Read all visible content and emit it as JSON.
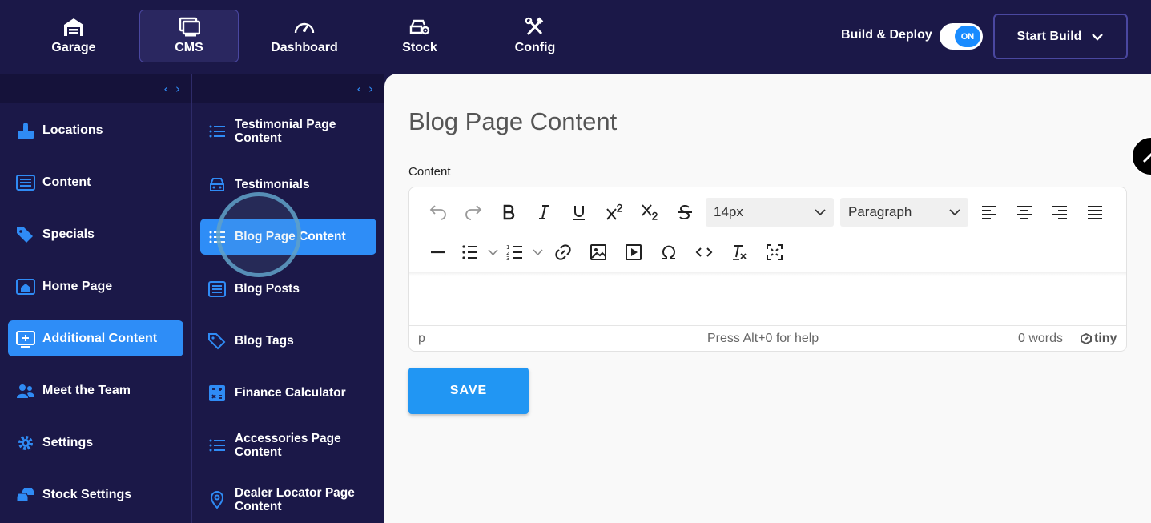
{
  "topnav": {
    "items": [
      {
        "label": "Garage",
        "icon": "garage-icon"
      },
      {
        "label": "CMS",
        "icon": "monitor-icon",
        "active": true
      },
      {
        "label": "Dashboard",
        "icon": "gauge-icon"
      },
      {
        "label": "Stock",
        "icon": "car-gear-icon"
      },
      {
        "label": "Config",
        "icon": "tools-icon"
      }
    ],
    "deploy_label": "Build & Deploy",
    "toggle_text": "ON",
    "start_build_label": "Start Build"
  },
  "sidebar": {
    "items": [
      {
        "label": "Locations",
        "icon": "location-building-icon"
      },
      {
        "label": "Content",
        "icon": "list-box-icon"
      },
      {
        "label": "Specials",
        "icon": "tags-icon"
      },
      {
        "label": "Home Page",
        "icon": "home-box-icon"
      },
      {
        "label": "Additional Content",
        "icon": "add-box-icon",
        "active": true
      },
      {
        "label": "Meet the Team",
        "icon": "people-icon"
      },
      {
        "label": "Settings",
        "icon": "gear-icon"
      },
      {
        "label": "Stock Settings",
        "icon": "cars-icon"
      }
    ]
  },
  "subnav": {
    "items": [
      {
        "label": "Testimonial Page Content",
        "icon": "list-icon"
      },
      {
        "label": "Testimonials",
        "icon": "car-icon"
      },
      {
        "label": "Blog Page Content",
        "icon": "list-icon",
        "active": true
      },
      {
        "label": "Blog Posts",
        "icon": "list-box-icon"
      },
      {
        "label": "Blog Tags",
        "icon": "tags-icon"
      },
      {
        "label": "Finance Calculator",
        "icon": "calculator-icon"
      },
      {
        "label": "Accessories Page Content",
        "icon": "list-icon"
      },
      {
        "label": "Dealer Locator Page Content",
        "icon": "map-pin-icon"
      }
    ]
  },
  "main": {
    "title": "Blog Page Content",
    "field_label": "Content",
    "editor": {
      "font_size": "14px",
      "block_format": "Paragraph",
      "status_path": "p",
      "help_text": "Press Alt+0 for help",
      "word_count": "0 words",
      "brand": "tiny"
    },
    "save_label": "SAVE"
  },
  "colors": {
    "nav_bg": "#1b1848",
    "accent": "#2e8df7",
    "save": "#2196f3",
    "content_bg": "#f9f9f9"
  }
}
